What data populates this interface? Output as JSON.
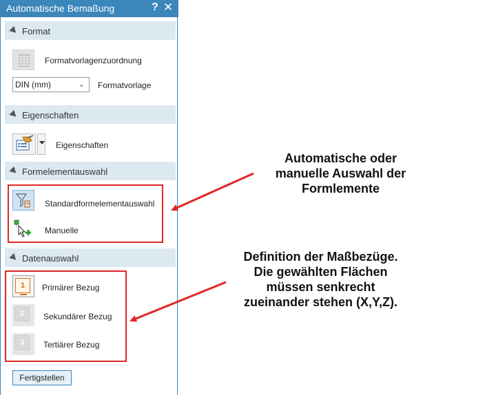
{
  "window": {
    "title": "Automatische Bemaßung",
    "help": "?",
    "close": "✕"
  },
  "sections": {
    "format": {
      "header": "Format",
      "template_assignment_label": "Formatvorlagenzuordnung",
      "select_value": "DIN (mm)",
      "select_label": "Formatvorlage"
    },
    "properties": {
      "header": "Eigenschaften",
      "button_label": "Eigenschaften"
    },
    "feature_selection": {
      "header": "Formelementauswahl",
      "standard_label": "Standardformelementauswahl",
      "manual_label": "Manuelle"
    },
    "data_selection": {
      "header": "Datenauswahl",
      "primary": {
        "num": "1",
        "label": "Primärer Bezug"
      },
      "secondary": {
        "num": "2",
        "label": "Sekundärer Bezug"
      },
      "tertiary": {
        "num": "3",
        "label": "Tertiärer Bezug"
      }
    }
  },
  "finish_button": "Fertigstellen",
  "annotations": {
    "top": [
      "Automatische oder",
      "manuelle Auswahl der",
      "Formlemente"
    ],
    "bottom": [
      "Definition der Maßbezüge.",
      "Die gewählten Flächen",
      "müssen senkrecht",
      "zueinander stehen (X,Y,Z)."
    ]
  },
  "colors": {
    "accent": "#3b86bb",
    "section_bg": "#dde9f1",
    "highlight_red": "#e02626"
  }
}
